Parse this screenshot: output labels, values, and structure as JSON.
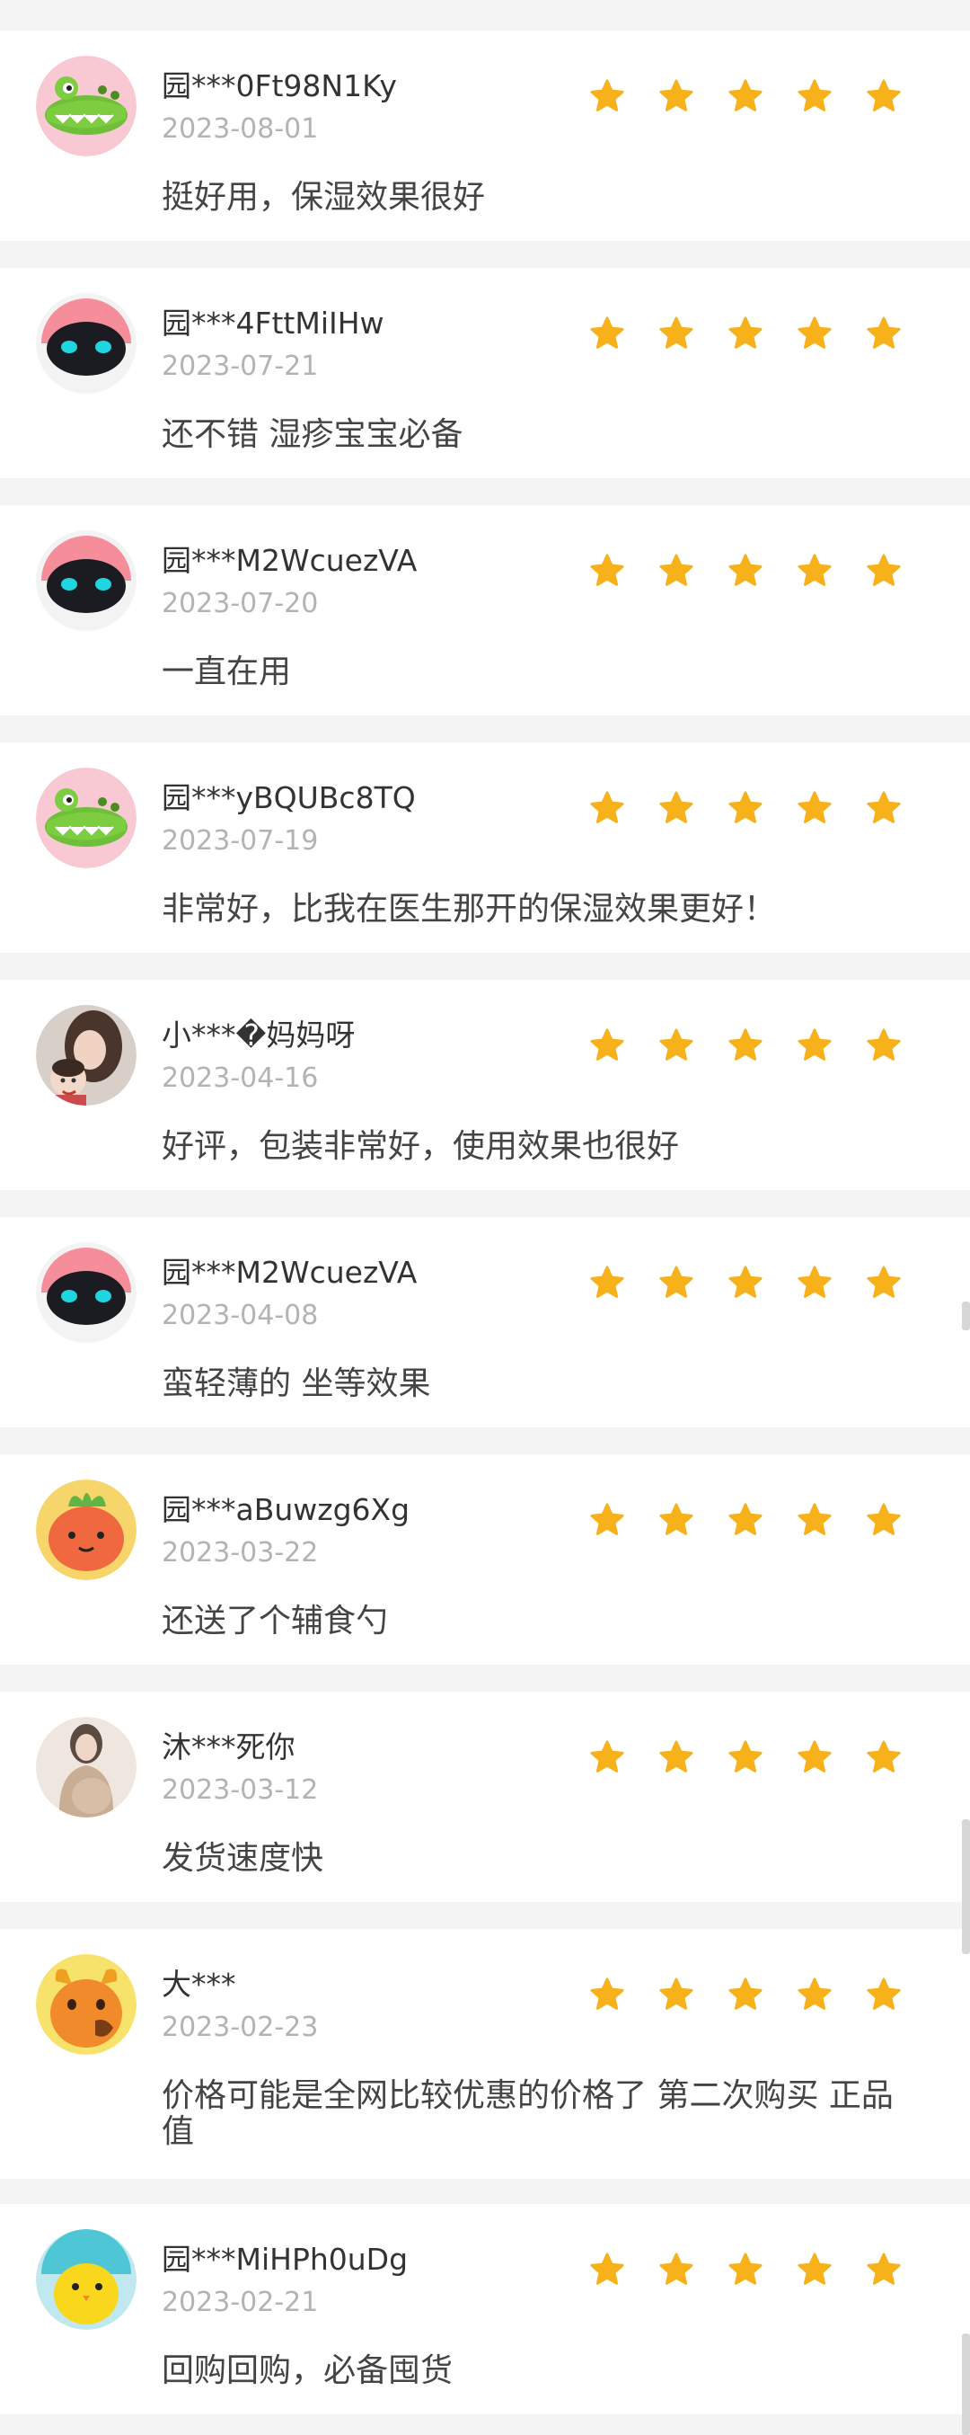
{
  "colors": {
    "background": "#f4f4f4",
    "card": "#ffffff",
    "star": "#f7b21b",
    "username": "#333333",
    "date": "#b3b3b3",
    "content": "#444444"
  },
  "reviews": [
    {
      "user": "园***0Ft98N1Ky",
      "date": "2023-08-01",
      "rating": 5,
      "text": "挺好用，保湿效果很好",
      "avatar": "crocodile-avatar"
    },
    {
      "user": "园***4FttMiIHw",
      "date": "2023-07-21",
      "rating": 5,
      "text": "还不错 湿疹宝宝必备",
      "avatar": "robot-avatar"
    },
    {
      "user": "园***M2WcuezVA",
      "date": "2023-07-20",
      "rating": 5,
      "text": "一直在用",
      "avatar": "robot-avatar"
    },
    {
      "user": "园***yBQUBc8TQ",
      "date": "2023-07-19",
      "rating": 5,
      "text": "非常好，比我在医生那开的保湿效果更好！",
      "avatar": "crocodile-avatar"
    },
    {
      "user": "小***�妈妈呀",
      "date": "2023-04-16",
      "rating": 5,
      "text": "好评，包装非常好，使用效果也很好",
      "avatar": "mother-child-photo-avatar"
    },
    {
      "user": "园***M2WcuezVA",
      "date": "2023-04-08",
      "rating": 5,
      "text": "蛮轻薄的 坐等效果",
      "avatar": "robot-avatar"
    },
    {
      "user": "园***aBuwzg6Xg",
      "date": "2023-03-22",
      "rating": 5,
      "text": "还送了个辅食勺",
      "avatar": "carrot-avatar"
    },
    {
      "user": "沐***死你",
      "date": "2023-03-12",
      "rating": 5,
      "text": "发货速度快",
      "avatar": "pregnant-woman-photo-avatar"
    },
    {
      "user": "大***",
      "date": "2023-02-23",
      "rating": 5,
      "text": "价格可能是全网比较优惠的价格了 第二次购买 正品 值",
      "avatar": "ox-avatar"
    },
    {
      "user": "园***MiHPh0uDg",
      "date": "2023-02-21",
      "rating": 5,
      "text": "回购回购，必备囤货",
      "avatar": "chick-avatar"
    }
  ]
}
